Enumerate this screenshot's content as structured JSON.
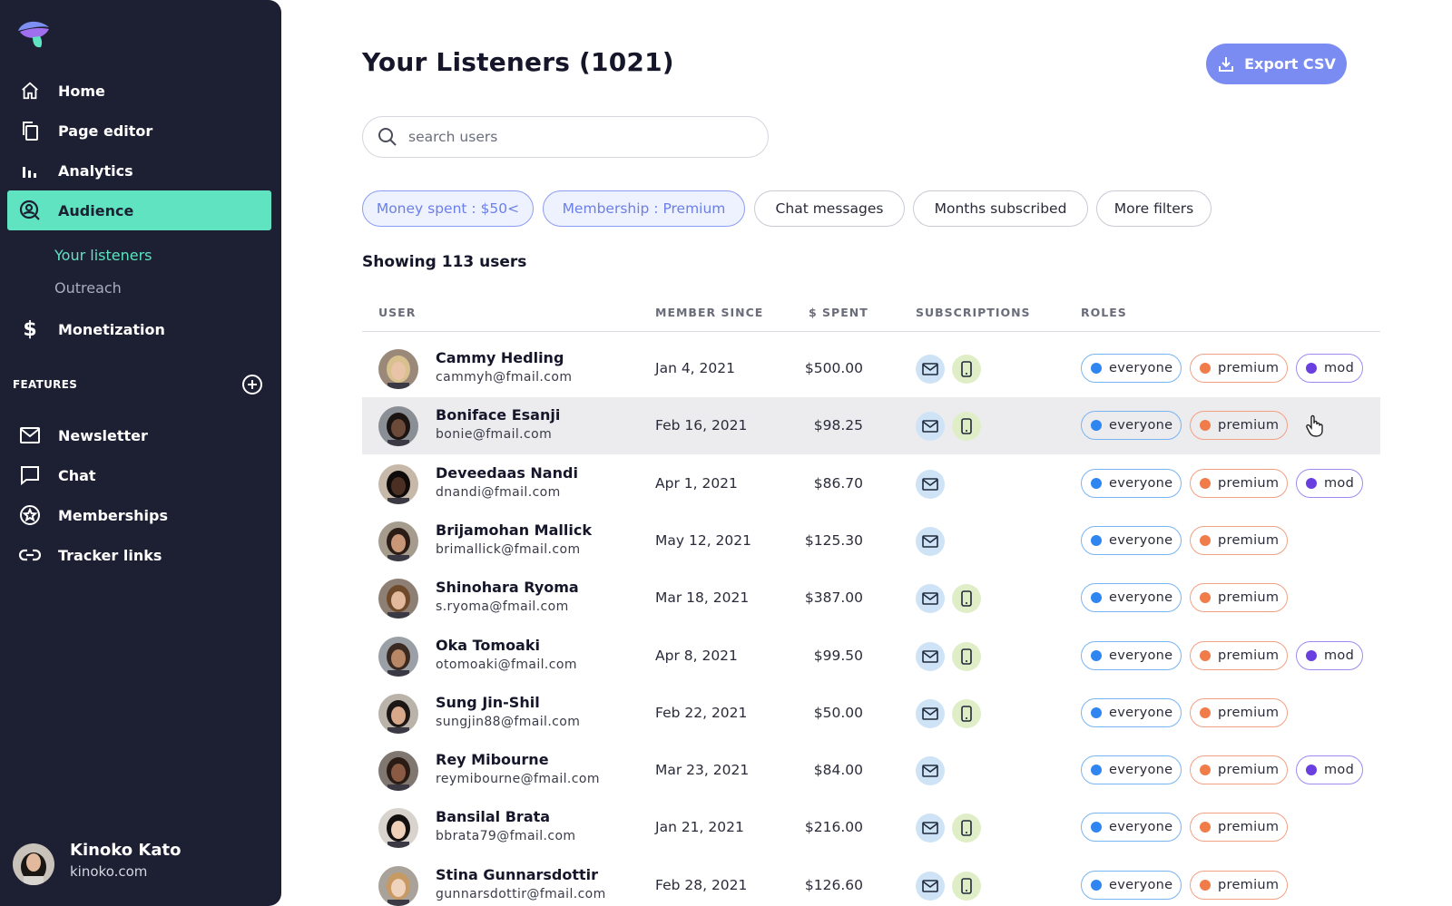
{
  "sidebar": {
    "nav": [
      {
        "label": "Home",
        "icon": "home-icon"
      },
      {
        "label": "Page editor",
        "icon": "pages-icon"
      },
      {
        "label": "Analytics",
        "icon": "bar-chart-icon"
      },
      {
        "label": "Audience",
        "icon": "audience-icon",
        "active": true
      },
      {
        "label": "Monetization",
        "icon": "dollar-icon"
      }
    ],
    "subnav": [
      {
        "label": "Your listeners",
        "current": true
      },
      {
        "label": "Outreach"
      }
    ],
    "features_heading": "FEATURES",
    "features": [
      {
        "label": "Newsletter",
        "icon": "mail-icon"
      },
      {
        "label": "Chat",
        "icon": "chat-icon"
      },
      {
        "label": "Memberships",
        "icon": "star-badge-icon"
      },
      {
        "label": "Tracker links",
        "icon": "link-icon"
      }
    ],
    "profile": {
      "name": "Kinoko Kato",
      "site": "kinoko.com"
    }
  },
  "header": {
    "title": "Your Listeners (1021)",
    "export_label": "Export CSV"
  },
  "search": {
    "placeholder": "search users",
    "value": ""
  },
  "filters": [
    {
      "label": "Money spent : $50<",
      "selected": true
    },
    {
      "label": "Membership : Premium",
      "selected": true
    },
    {
      "label": "Chat messages",
      "selected": false
    },
    {
      "label": "Months subscribed",
      "selected": false
    },
    {
      "label": "More filters",
      "selected": false
    }
  ],
  "showing": "Showing 113 users",
  "table": {
    "headers": [
      "USER",
      "MEMBER SINCE",
      "$ SPENT",
      "SUBSCRIPTIONS",
      "ROLES"
    ],
    "role_labels": {
      "everyone": "everyone",
      "premium": "premium",
      "mod": "mod"
    },
    "rows": [
      {
        "name": "Cammy Hedling",
        "email": "cammyh@fmail.com",
        "since": "Jan 4, 2021",
        "spent": "$500.00",
        "subs": [
          "mail",
          "phone"
        ],
        "roles": [
          "everyone",
          "premium",
          "mod"
        ]
      },
      {
        "name": "Boniface Esanji",
        "email": "bonie@fmail.com",
        "since": "Feb 16, 2021",
        "spent": "$98.25",
        "subs": [
          "mail",
          "phone"
        ],
        "roles": [
          "everyone",
          "premium"
        ],
        "hover": true
      },
      {
        "name": "Deveedaas Nandi",
        "email": "dnandi@fmail.com",
        "since": "Apr 1, 2021",
        "spent": "$86.70",
        "subs": [
          "mail"
        ],
        "roles": [
          "everyone",
          "premium",
          "mod"
        ]
      },
      {
        "name": "Brijamohan Mallick",
        "email": "brimallick@fmail.com",
        "since": "May 12, 2021",
        "spent": "$125.30",
        "subs": [
          "mail"
        ],
        "roles": [
          "everyone",
          "premium"
        ]
      },
      {
        "name": "Shinohara Ryoma",
        "email": "s.ryoma@fmail.com",
        "since": "Mar 18, 2021",
        "spent": "$387.00",
        "subs": [
          "mail",
          "phone"
        ],
        "roles": [
          "everyone",
          "premium"
        ]
      },
      {
        "name": "Oka Tomoaki",
        "email": "otomoaki@fmail.com",
        "since": "Apr 8, 2021",
        "spent": "$99.50",
        "subs": [
          "mail",
          "phone"
        ],
        "roles": [
          "everyone",
          "premium",
          "mod"
        ]
      },
      {
        "name": "Sung Jin-Shil",
        "email": "sungjin88@fmail.com",
        "since": "Feb 22, 2021",
        "spent": "$50.00",
        "subs": [
          "mail",
          "phone"
        ],
        "roles": [
          "everyone",
          "premium"
        ]
      },
      {
        "name": "Rey Mibourne",
        "email": "reymibourne@fmail.com",
        "since": "Mar 23, 2021",
        "spent": "$84.00",
        "subs": [
          "mail"
        ],
        "roles": [
          "everyone",
          "premium",
          "mod"
        ]
      },
      {
        "name": "Bansilal Brata",
        "email": "bbrata79@fmail.com",
        "since": "Jan 21, 2021",
        "spent": "$216.00",
        "subs": [
          "mail",
          "phone"
        ],
        "roles": [
          "everyone",
          "premium"
        ]
      },
      {
        "name": "Stina Gunnarsdottir",
        "email": "gunnarsdottir@fmail.com",
        "since": "Feb 28, 2021",
        "spent": "$126.60",
        "subs": [
          "mail",
          "phone"
        ],
        "roles": [
          "everyone",
          "premium"
        ]
      }
    ]
  },
  "colors": {
    "sidebar_bg": "#1d1f33",
    "accent_teal": "#5fe3c1",
    "accent_blue": "#7a8cf2",
    "role_everyone": "#2f86f0",
    "role_premium": "#f07c4a",
    "role_mod": "#6a3fe0"
  }
}
